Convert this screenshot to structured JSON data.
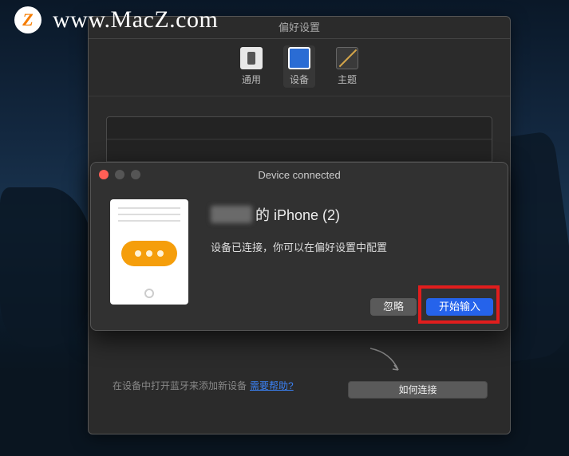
{
  "watermark": {
    "logo_letter": "Z",
    "text": "www.MacZ.com"
  },
  "prefs": {
    "title": "偏好设置",
    "tabs": {
      "general": "通用",
      "device": "设备",
      "theme": "主题"
    },
    "help_text": "在设备中打开蓝牙来添加新设备",
    "help_link": "需要帮助?",
    "how_connect": "如何连接"
  },
  "dialog": {
    "title": "Device connected",
    "device_suffix": "的 iPhone (2)",
    "description": "设备已连接，你可以在偏好设置中配置",
    "ignore": "忽略",
    "start_input": "开始输入"
  }
}
